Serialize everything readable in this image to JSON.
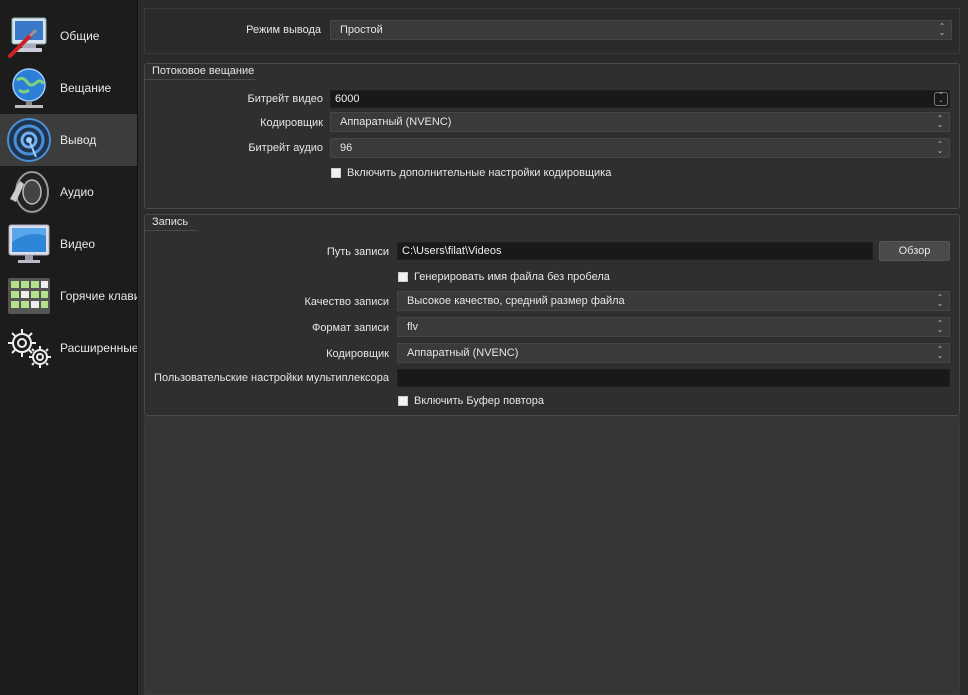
{
  "sidebar": {
    "items": [
      {
        "label": "Общие",
        "icon": "general-settings-icon"
      },
      {
        "label": "Вещание",
        "icon": "globe-broadcast-icon"
      },
      {
        "label": "Вывод",
        "icon": "output-signal-icon"
      },
      {
        "label": "Аудио",
        "icon": "speaker-icon"
      },
      {
        "label": "Видео",
        "icon": "monitor-icon"
      },
      {
        "label": "Горячие клавиши",
        "icon": "keyboard-icon"
      },
      {
        "label": "Расширенные",
        "icon": "gears-icon"
      }
    ],
    "active_index": 2
  },
  "output_mode": {
    "label": "Режим вывода",
    "value": "Простой"
  },
  "streaming": {
    "title": "Потоковое вещание",
    "video_bitrate": {
      "label": "Битрейт видео",
      "value": "6000"
    },
    "encoder": {
      "label": "Кодировщик",
      "value": "Аппаратный (NVENC)"
    },
    "audio_bitrate": {
      "label": "Битрейт аудио",
      "value": "96"
    },
    "advanced_checkbox": {
      "label": "Включить дополнительные настройки кодировщика",
      "checked": false
    }
  },
  "recording": {
    "title": "Запись",
    "path": {
      "label": "Путь записи",
      "value": "C:\\Users\\filat\\Videos"
    },
    "browse_label": "Обзор",
    "no_space_checkbox": {
      "label": "Генерировать имя файла без пробела",
      "checked": false
    },
    "quality": {
      "label": "Качество записи",
      "value": "Высокое качество, средний размер файла"
    },
    "format": {
      "label": "Формат записи",
      "value": "flv"
    },
    "encoder": {
      "label": "Кодировщик",
      "value": "Аппаратный (NVENC)"
    },
    "muxer": {
      "label": "Пользовательские настройки мультиплексора",
      "value": ""
    },
    "replay_checkbox": {
      "label": "Включить Буфер повтора",
      "checked": false
    }
  }
}
